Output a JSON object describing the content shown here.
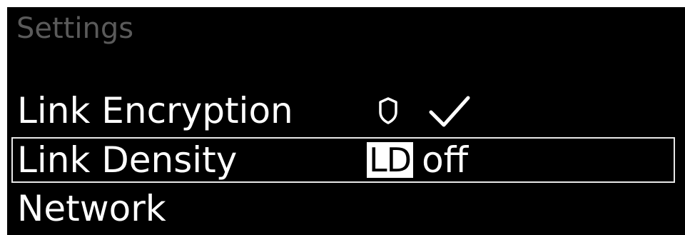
{
  "screen": {
    "title": "Settings",
    "background_color": "#000000",
    "title_color": "#5a5a5a",
    "text_color": "#ffffff",
    "selection_border_color": "#e8e8e8"
  },
  "menu": {
    "items": [
      {
        "label": "Link Encryption",
        "value_icons": [
          "shield-icon",
          "check-icon"
        ],
        "selected": false
      },
      {
        "label": "Link Density",
        "badge": "LD",
        "value": "off",
        "selected": true
      },
      {
        "label": "Network",
        "selected": false
      }
    ]
  }
}
